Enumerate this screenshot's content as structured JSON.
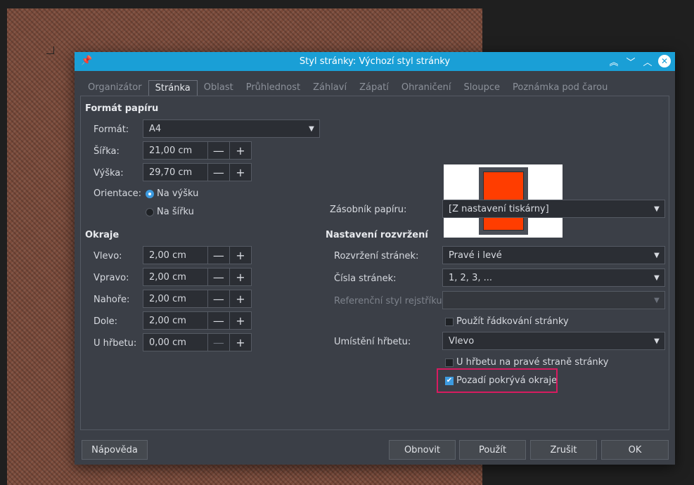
{
  "dialog": {
    "title": "Styl stránky: Výchozí styl stránky"
  },
  "tabs": [
    "Organizátor",
    "Stránka",
    "Oblast",
    "Průhlednost",
    "Záhlaví",
    "Zápatí",
    "Ohraničení",
    "Sloupce",
    "Poznámka pod čarou"
  ],
  "active_tab": "Stránka",
  "paper": {
    "title": "Formát papíru",
    "format_label": "Formát:",
    "format_value": "A4",
    "width_label": "Šířka:",
    "width_value": "21,00 cm",
    "height_label": "Výška:",
    "height_value": "29,70 cm",
    "orientation_label": "Orientace:",
    "portrait_label": "Na výšku",
    "landscape_label": "Na šířku",
    "tray_label": "Zásobník papíru:",
    "tray_value": "[Z nastavení tiskárny]"
  },
  "margins": {
    "title": "Okraje",
    "left_label": "Vlevo:",
    "left_value": "2,00 cm",
    "right_label": "Vpravo:",
    "right_value": "2,00 cm",
    "top_label": "Nahoře:",
    "top_value": "2,00 cm",
    "bottom_label": "Dole:",
    "bottom_value": "2,00 cm",
    "gutter_label": "U hřbetu:",
    "gutter_value": "0,00 cm"
  },
  "layout": {
    "title": "Nastavení rozvržení",
    "page_layout_label": "Rozvržení stránek:",
    "page_layout_value": "Pravé i levé",
    "page_numbers_label": "Čísla stránek:",
    "page_numbers_value": "1, 2, 3, ...",
    "ref_style_label": "Referenční styl rejstříku:",
    "ref_style_value": "",
    "use_spacing_label": "Použít řádkování stránky",
    "gutter_pos_label": "Umístění hřbetu:",
    "gutter_pos_value": "Vlevo",
    "gutter_right_label": "U hřbetu na pravé straně stránky",
    "background_covers_label": "Pozadí pokrývá okraje"
  },
  "buttons": {
    "help": "Nápověda",
    "reset": "Obnovit",
    "apply": "Použít",
    "cancel": "Zrušit",
    "ok": "OK"
  },
  "spin": {
    "minus": "—",
    "plus": "+"
  },
  "colors": {
    "accent": "#1a9fd6",
    "highlight": "#d81b60",
    "preview_page": "#ff3d00"
  }
}
